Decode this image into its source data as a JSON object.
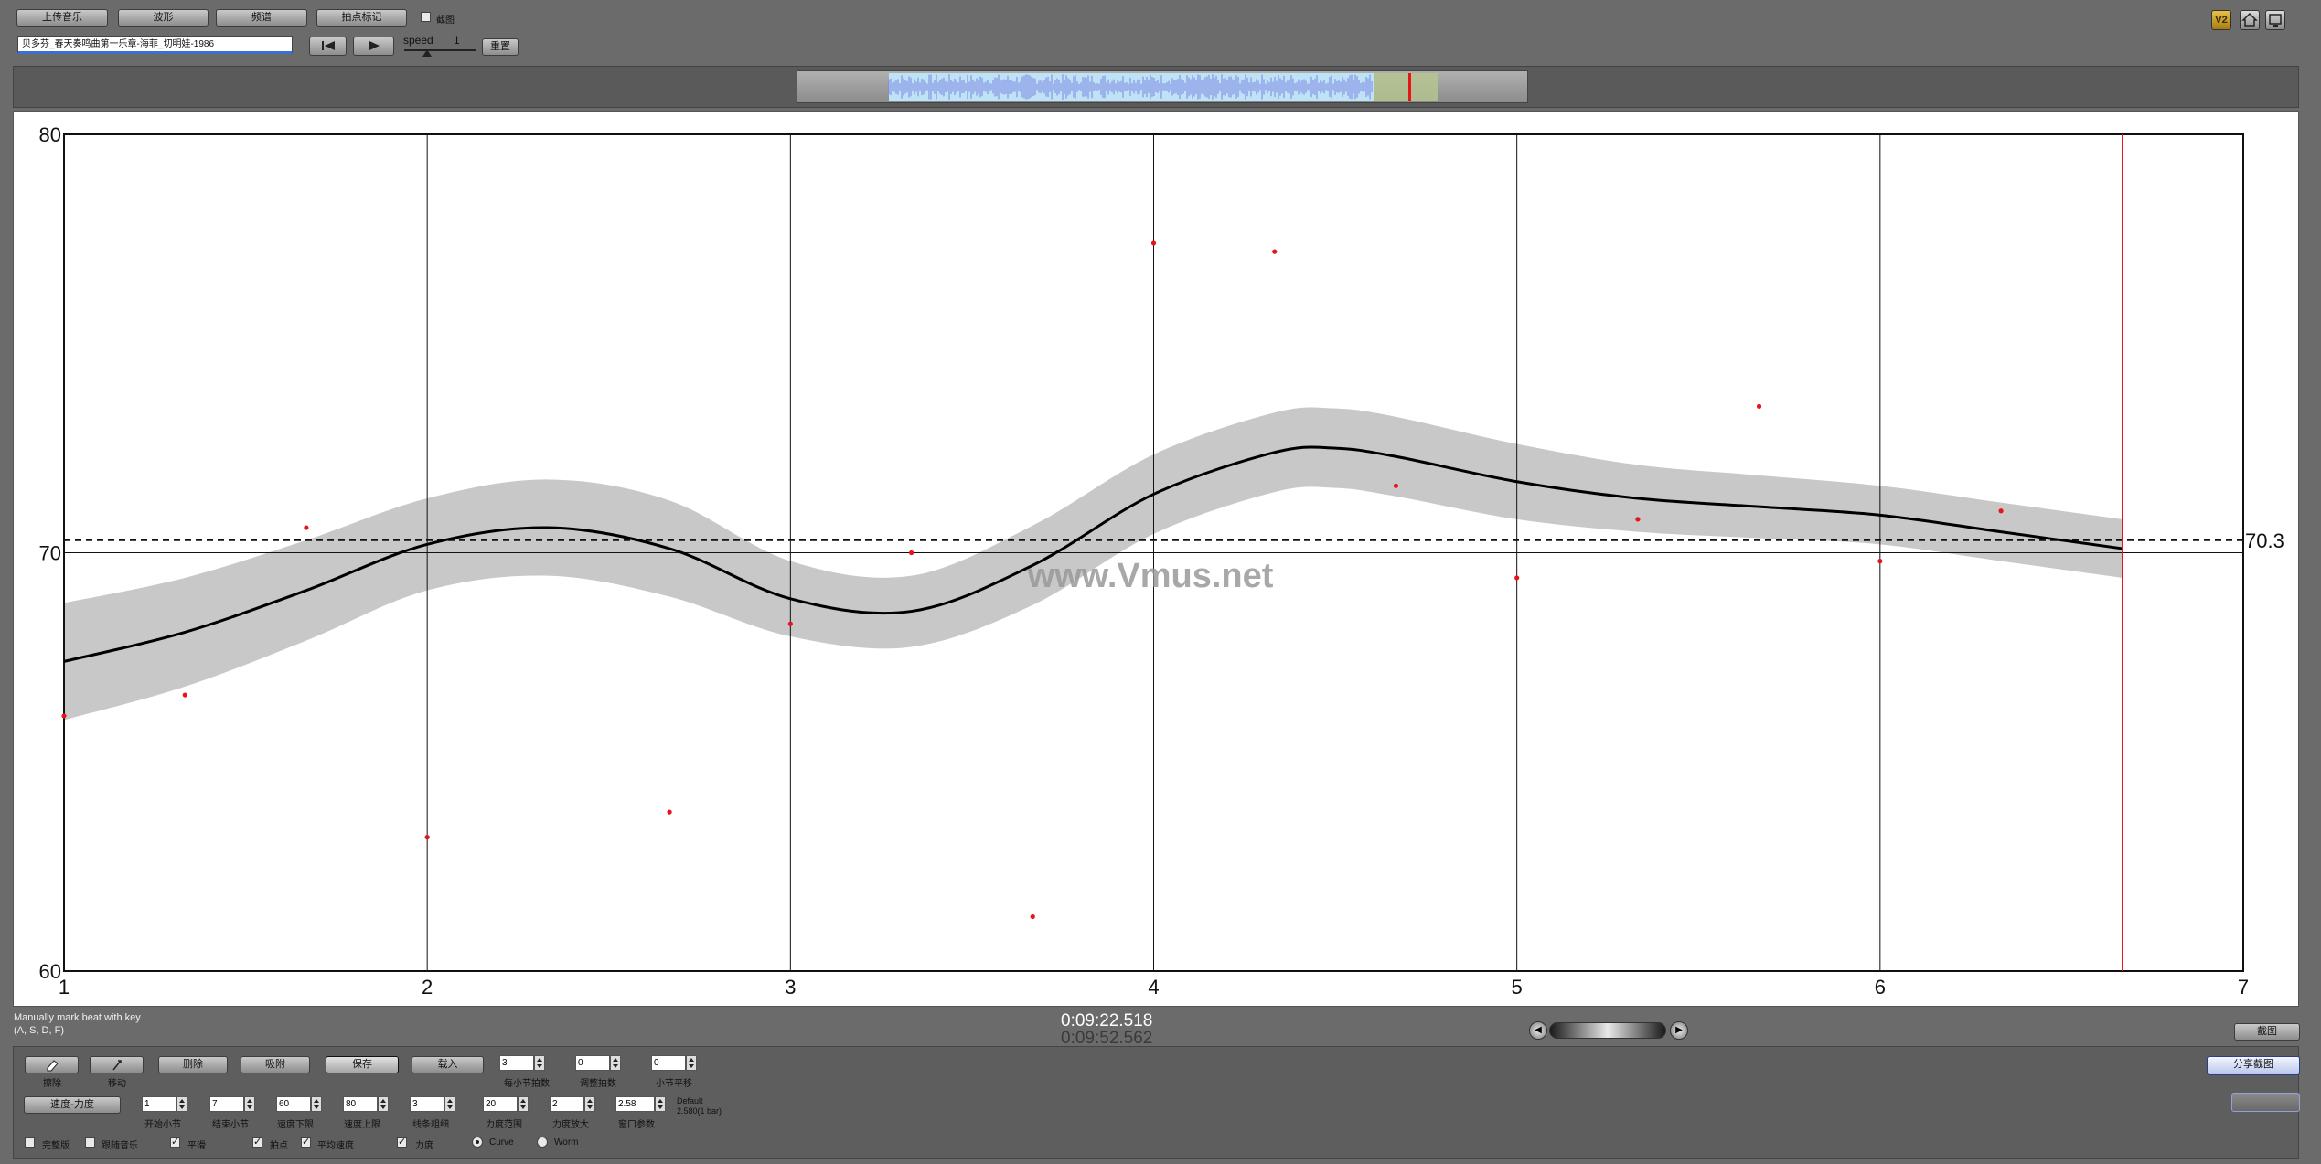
{
  "toolbar": {
    "upload_music": "上传音乐",
    "waveform": "波形",
    "spectrum": "频谱",
    "beat_mark": "拍点标记",
    "screenshot_label": "截图",
    "filename": "贝多芬_春天奏鸣曲第一乐章-海菲_切明娃-1986",
    "speed_label": "speed",
    "speed_value": "1",
    "reset": "重置",
    "v2_badge": "V2"
  },
  "chart_data": {
    "type": "line",
    "xlim": [
      1,
      7
    ],
    "ylim": [
      60,
      80
    ],
    "x_ticks": [
      "1",
      "2",
      "3",
      "4",
      "5",
      "6",
      "7"
    ],
    "y_ticks": [
      "60",
      "70",
      "80"
    ],
    "reference_value": 70.3,
    "reference_label": "70.3",
    "watermark": "www.Vmus.net",
    "beat_points": [
      {
        "x": 1.0,
        "y": 66.1
      },
      {
        "x": 1.333,
        "y": 66.6
      },
      {
        "x": 1.667,
        "y": 70.6
      },
      {
        "x": 2.0,
        "y": 63.2
      },
      {
        "x": 2.667,
        "y": 63.8
      },
      {
        "x": 3.0,
        "y": 68.3
      },
      {
        "x": 3.333,
        "y": 70.0
      },
      {
        "x": 3.667,
        "y": 61.3
      },
      {
        "x": 4.0,
        "y": 77.4
      },
      {
        "x": 4.333,
        "y": 77.2
      },
      {
        "x": 4.667,
        "y": 71.6
      },
      {
        "x": 5.0,
        "y": 69.4
      },
      {
        "x": 5.333,
        "y": 70.8
      },
      {
        "x": 5.667,
        "y": 73.5
      },
      {
        "x": 6.0,
        "y": 69.8
      },
      {
        "x": 6.333,
        "y": 71.0
      }
    ],
    "smooth_curve": [
      {
        "x": 1.0,
        "y": 67.4
      },
      {
        "x": 1.333,
        "y": 68.1
      },
      {
        "x": 1.667,
        "y": 69.1
      },
      {
        "x": 2.0,
        "y": 70.2
      },
      {
        "x": 2.333,
        "y": 70.6
      },
      {
        "x": 2.667,
        "y": 70.1
      },
      {
        "x": 3.0,
        "y": 68.9
      },
      {
        "x": 3.333,
        "y": 68.6
      },
      {
        "x": 3.667,
        "y": 69.7
      },
      {
        "x": 4.0,
        "y": 71.4
      },
      {
        "x": 4.333,
        "y": 72.4
      },
      {
        "x": 4.5,
        "y": 72.5
      },
      {
        "x": 4.667,
        "y": 72.3
      },
      {
        "x": 5.0,
        "y": 71.7
      },
      {
        "x": 5.333,
        "y": 71.3
      },
      {
        "x": 5.667,
        "y": 71.1
      },
      {
        "x": 6.0,
        "y": 70.9
      },
      {
        "x": 6.333,
        "y": 70.5
      },
      {
        "x": 6.667,
        "y": 70.1
      }
    ],
    "band_halfwidth": [
      1.4,
      1.3,
      1.2,
      1.1,
      1.15,
      1.15,
      0.9,
      0.85,
      0.95,
      0.95,
      0.95,
      0.95,
      0.95,
      0.9,
      0.8,
      0.75,
      0.7,
      0.7,
      0.7
    ],
    "current_position": 6.667,
    "colors": {
      "points": "#e8141a",
      "curve": "#000000",
      "band": "#c8c8c8",
      "cursor": "#e8141a",
      "background": "#ffffff"
    }
  },
  "status": {
    "hint_line1": "Manually mark beat with key",
    "hint_line2": "(A, S, D, F)",
    "time_current": "0:09:22.518",
    "time_total": "0:09:52.562",
    "screenshot_button": "截图"
  },
  "controls": {
    "erase": "擦除",
    "move": "移动",
    "delete": "删除",
    "snap": "吸附",
    "save": "保存",
    "load": "载入",
    "beats_per_bar_value": "3",
    "beats_per_bar_label": "每小节拍数",
    "adjust_beat_value": "0",
    "adjust_beat_label": "调整拍数",
    "bar_smooth_value": "0",
    "bar_smooth_label": "小节平移",
    "share": "分享截图",
    "mode_select": "速度-力度",
    "start_bar_value": "1",
    "start_bar_label": "开始小节",
    "end_bar_value": "7",
    "end_bar_label": "结束小节",
    "tempo_low_value": "60",
    "tempo_low_label": "速度下限",
    "tempo_high_value": "80",
    "tempo_high_label": "速度上限",
    "line_width_value": "3",
    "line_width_label": "线条粗细",
    "dyn_range_value": "20",
    "dyn_range_label": "力度范围",
    "dyn_zoom_value": "2",
    "dyn_zoom_label": "力度放大",
    "window_value": "2.58",
    "window_label": "窗口参数",
    "default_line1": "Default",
    "default_line2": "2.580(1 bar)",
    "cb_full": "完整版",
    "cb_follow": "跟随音乐",
    "cb_smooth": "平滑",
    "cb_beats": "拍点",
    "cb_avg_tempo": "平均速度",
    "cb_dynamics": "力度",
    "radio_curve": "Curve",
    "radio_worm": "Worm"
  }
}
